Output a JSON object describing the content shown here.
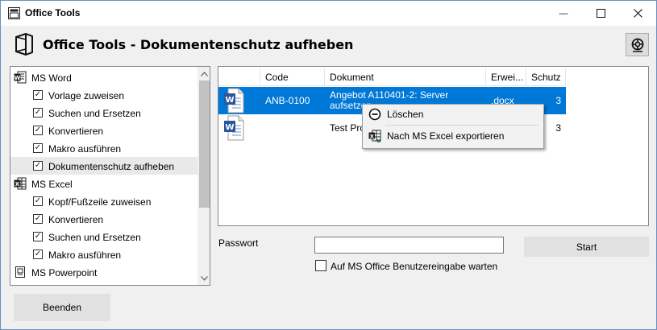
{
  "window": {
    "title": "Office Tools",
    "minimize_glyph": "—",
    "maximize_glyph": "☐",
    "close_glyph": "✕"
  },
  "header": {
    "title": "Office Tools - Dokumentenschutz aufheben",
    "help_icon": "lifebuoy-icon"
  },
  "tree": {
    "groups": [
      {
        "label": "MS Word",
        "icon": "word-icon",
        "items": [
          {
            "label": "Vorlage zuweisen",
            "checked": true
          },
          {
            "label": "Suchen und Ersetzen",
            "checked": true
          },
          {
            "label": "Konvertieren",
            "checked": true
          },
          {
            "label": "Makro ausführen",
            "checked": true
          },
          {
            "label": "Dokumentenschutz aufheben",
            "checked": true,
            "selected": true
          }
        ]
      },
      {
        "label": "MS Excel",
        "icon": "excel-icon",
        "items": [
          {
            "label": "Kopf/Fußzeile zuweisen",
            "checked": true
          },
          {
            "label": "Konvertieren",
            "checked": true
          },
          {
            "label": "Suchen und Ersetzen",
            "checked": true
          },
          {
            "label": "Makro ausführen",
            "checked": true
          }
        ]
      },
      {
        "label": "MS Powerpoint",
        "icon": "powerpoint-icon",
        "items": []
      }
    ],
    "check_glyph": "✓"
  },
  "grid": {
    "columns": [
      "Code",
      "Dokument",
      "Erwei...",
      "Schutz"
    ],
    "rows": [
      {
        "icon": "word-document-icon",
        "code": "ANB-0100",
        "dokument": "Angebot A110401-2: Server aufsetzen",
        "erweiterung": ".docx",
        "schutz": "3",
        "selected": true
      },
      {
        "icon": "word-document-icon",
        "code": "",
        "dokument": "Test Prot",
        "erweiterung": "",
        "schutz": "3",
        "selected": false
      }
    ]
  },
  "context_menu": {
    "items": [
      {
        "label": "Löschen",
        "icon": "minus-circle-icon"
      },
      {
        "label": "Nach MS Excel exportieren",
        "icon": "excel-export-icon"
      }
    ]
  },
  "form": {
    "password_label": "Passwort",
    "password_value": "",
    "start_label": "Start",
    "wait_label": "Auf MS Office Benutzereingabe warten",
    "wait_checked": false
  },
  "footer": {
    "end_label": "Beenden"
  },
  "colors": {
    "selection": "#0078d7",
    "word_blue": "#2b579a",
    "excel_green": "#217346"
  }
}
